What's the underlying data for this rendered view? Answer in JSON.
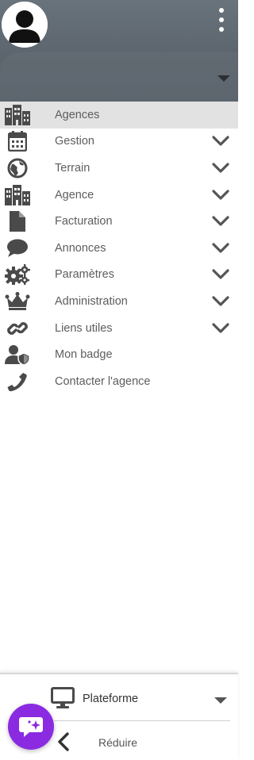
{
  "colors": {
    "header_bg": "#5f6970",
    "active_item_bg": "#e2e2e2",
    "icon": "#4a4a4a",
    "chat_fab": "#8a2be2"
  },
  "header": {
    "avatar_icon": "user-avatar-icon",
    "more_icon": "kebab-menu-icon"
  },
  "menu": {
    "items": [
      {
        "label": "Agences",
        "icon": "buildings-icon",
        "expandable": false,
        "active": true
      },
      {
        "label": "Gestion",
        "icon": "calendar-icon",
        "expandable": true
      },
      {
        "label": "Terrain",
        "icon": "globe-icon",
        "expandable": true
      },
      {
        "label": "Agence",
        "icon": "buildings-icon",
        "expandable": true
      },
      {
        "label": "Facturation",
        "icon": "document-icon",
        "expandable": true
      },
      {
        "label": "Annonces",
        "icon": "speech-bubble-icon",
        "expandable": true
      },
      {
        "label": "Paramètres",
        "icon": "gears-icon",
        "expandable": true
      },
      {
        "label": "Administration",
        "icon": "crown-icon",
        "expandable": true
      },
      {
        "label": "Liens utiles",
        "icon": "link-icon",
        "expandable": true
      },
      {
        "label": "Mon badge",
        "icon": "user-shield-icon",
        "expandable": false
      },
      {
        "label": "Contacter l'agence",
        "icon": "phone-icon",
        "expandable": false
      }
    ]
  },
  "footer": {
    "platform_label": "Plateforme",
    "platform_icon": "monitor-icon",
    "reduce_label": "Réduire",
    "reduce_icon": "chevron-left-icon",
    "chat_icon": "chat-sparkle-icon"
  }
}
